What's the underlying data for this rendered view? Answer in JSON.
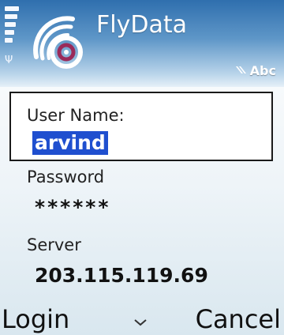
{
  "status": {
    "signal_bars": 5,
    "antenna_icon": "antenna-icon",
    "input_mode_label": "Abc",
    "input_mode_icon": "pen-input-icon"
  },
  "header": {
    "app_title": "FlyData",
    "logo_icon": "flydata-logo-icon"
  },
  "form": {
    "username": {
      "label": "User Name:",
      "value": "arvind"
    },
    "password": {
      "label": "Password",
      "value": "******"
    },
    "server": {
      "label": "Server",
      "value": "203.115.119.69"
    }
  },
  "softkeys": {
    "left": "Login",
    "right": "Cancel",
    "scroll_icon": "chevron-down-icon"
  },
  "colors": {
    "header_top": "#2f6fae",
    "selection": "#1f4fcf",
    "text": "#111111"
  }
}
